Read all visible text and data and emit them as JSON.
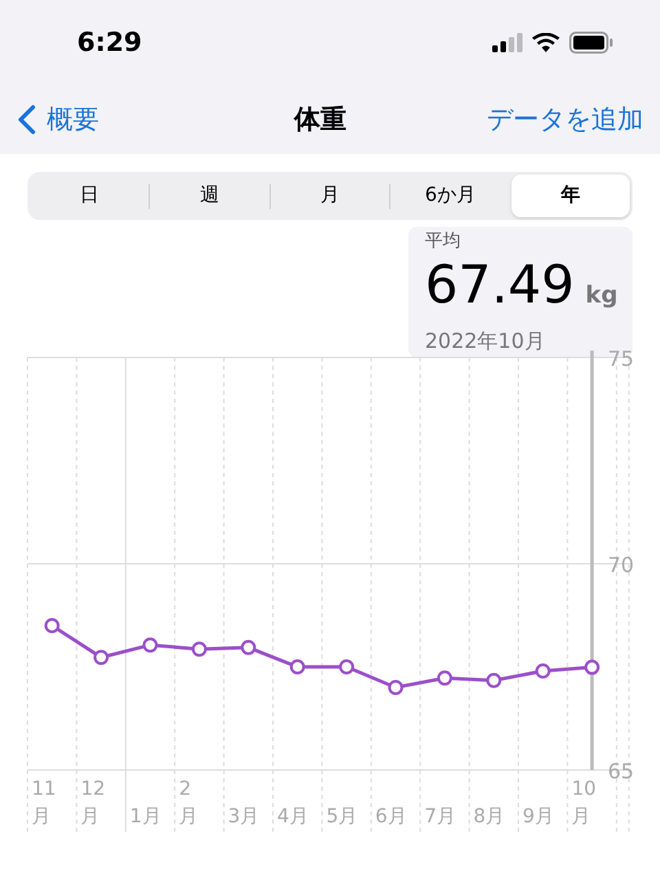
{
  "status_bar": {
    "time": "6:29"
  },
  "nav": {
    "back": "概要",
    "title": "体重",
    "action": "データを追加"
  },
  "segments": [
    {
      "label": "日",
      "selected": false
    },
    {
      "label": "週",
      "selected": false
    },
    {
      "label": "月",
      "selected": false
    },
    {
      "label": "6か月",
      "selected": false
    },
    {
      "label": "年",
      "selected": true
    }
  ],
  "summary": {
    "label": "平均",
    "value": "67.49",
    "unit": "kg",
    "period": "2022年10月"
  },
  "chart_data": {
    "type": "line",
    "categories": [
      "11\n月",
      "12\n月",
      "1月",
      "2\n月",
      "3月",
      "4月",
      "5月",
      "6月",
      "7月",
      "8月",
      "9月",
      "10\n月"
    ],
    "ylim": [
      65,
      75
    ],
    "yticks": [
      65,
      70,
      75
    ],
    "series": [
      {
        "color": "#9b4fc9",
        "marker": "circle",
        "values": [
          68.5,
          67.73,
          68.03,
          67.93,
          67.97,
          67.5,
          67.5,
          67.0,
          67.23,
          67.17,
          67.4,
          67.49
        ]
      }
    ]
  }
}
